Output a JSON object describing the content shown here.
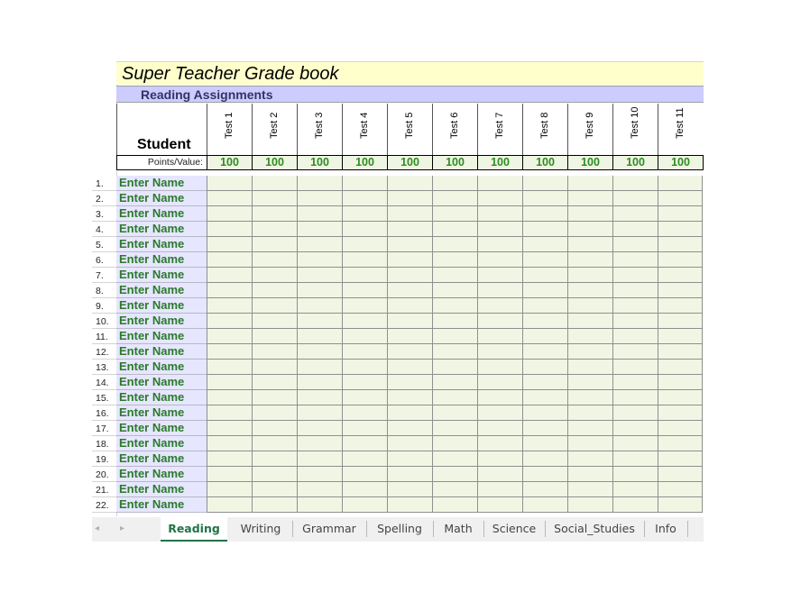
{
  "sheet": {
    "title": "Super Teacher Grade book",
    "subtitle": "Reading Assignments",
    "student_header": "Student",
    "points_label": "Points/Value:",
    "tests": [
      {
        "label": "Test 1",
        "points": "100"
      },
      {
        "label": "Test 2",
        "points": "100"
      },
      {
        "label": "Test 3",
        "points": "100"
      },
      {
        "label": "Test 4",
        "points": "100"
      },
      {
        "label": "Test 5",
        "points": "100"
      },
      {
        "label": "Test 6",
        "points": "100"
      },
      {
        "label": "Test 7",
        "points": "100"
      },
      {
        "label": "Test 8",
        "points": "100"
      },
      {
        "label": "Test 9",
        "points": "100"
      },
      {
        "label": "Test 10",
        "points": "100"
      },
      {
        "label": "Test 11",
        "points": "100"
      }
    ],
    "students": [
      {
        "num": "1.",
        "name": "Enter Name"
      },
      {
        "num": "2.",
        "name": "Enter Name"
      },
      {
        "num": "3.",
        "name": "Enter Name"
      },
      {
        "num": "4.",
        "name": "Enter Name"
      },
      {
        "num": "5.",
        "name": "Enter Name"
      },
      {
        "num": "6.",
        "name": "Enter Name"
      },
      {
        "num": "7.",
        "name": "Enter Name"
      },
      {
        "num": "8.",
        "name": "Enter Name"
      },
      {
        "num": "9.",
        "name": "Enter Name"
      },
      {
        "num": "10.",
        "name": "Enter Name"
      },
      {
        "num": "11.",
        "name": "Enter Name"
      },
      {
        "num": "12.",
        "name": "Enter Name"
      },
      {
        "num": "13.",
        "name": "Enter Name"
      },
      {
        "num": "14.",
        "name": "Enter Name"
      },
      {
        "num": "15.",
        "name": "Enter Name"
      },
      {
        "num": "16.",
        "name": "Enter Name"
      },
      {
        "num": "17.",
        "name": "Enter Name"
      },
      {
        "num": "18.",
        "name": "Enter Name"
      },
      {
        "num": "19.",
        "name": "Enter Name"
      },
      {
        "num": "20.",
        "name": "Enter Name"
      },
      {
        "num": "21.",
        "name": "Enter Name"
      },
      {
        "num": "22.",
        "name": "Enter Name"
      }
    ]
  },
  "tabs": {
    "nav_prev": "◂",
    "nav_next": "▸",
    "items": [
      {
        "label": "Reading",
        "active": true
      },
      {
        "label": "Writing",
        "active": false
      },
      {
        "label": "Grammar",
        "active": false
      },
      {
        "label": "Spelling",
        "active": false
      },
      {
        "label": "Math",
        "active": false
      },
      {
        "label": "Science",
        "active": false
      },
      {
        "label": "Social_Studies",
        "active": false
      },
      {
        "label": "Info",
        "active": false
      }
    ]
  },
  "colors": {
    "title_bg": "#ffffcc",
    "subtitle_bg": "#ccccff",
    "name_text": "#2a7a2a",
    "grade_cell_bg": "#f1f6e4",
    "active_tab": "#217346"
  }
}
